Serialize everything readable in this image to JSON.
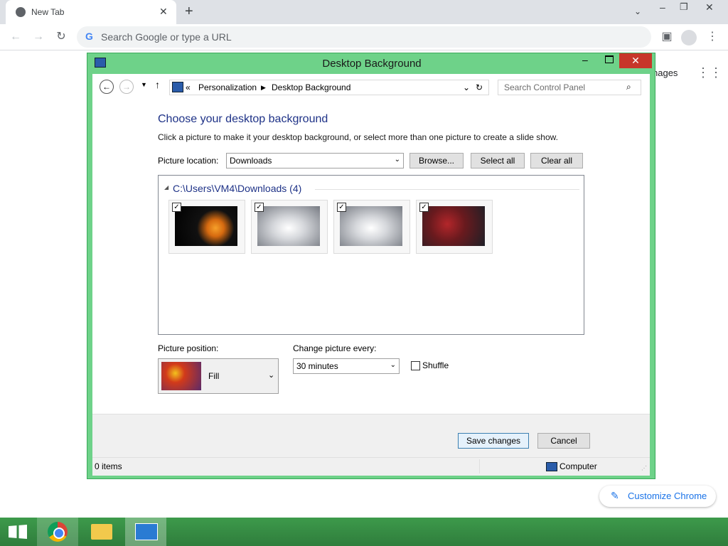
{
  "browser": {
    "tab_title": "New Tab",
    "omnibox_placeholder": "Search Google or type a URL",
    "partial_images_link": "nages",
    "customize_label": "Customize Chrome"
  },
  "window": {
    "title": "Desktop Background",
    "breadcrumb": [
      "Personalization",
      "Desktop Background"
    ],
    "breadcrumb_prefix": "«",
    "search_placeholder": "Search Control Panel",
    "heading": "Choose your desktop background",
    "subtext": "Click a picture to make it your desktop background, or select more than one picture to create a slide show.",
    "picture_location_label": "Picture location:",
    "picture_location_value": "Downloads",
    "browse_label": "Browse...",
    "select_all_label": "Select all",
    "clear_all_label": "Clear all",
    "group_label": "C:\\Users\\VM4\\Downloads (4)",
    "thumbnails": [
      {
        "name": "windows-logo-wallpaper",
        "checked": true
      },
      {
        "name": "gray-gradient-wallpaper-1",
        "checked": true
      },
      {
        "name": "gray-gradient-wallpaper-2",
        "checked": true
      },
      {
        "name": "red-soldiers-wallpaper",
        "checked": true
      }
    ],
    "picture_position_label": "Picture position:",
    "picture_position_value": "Fill",
    "change_every_label": "Change picture every:",
    "change_every_value": "30 minutes",
    "shuffle_label": "Shuffle",
    "save_label": "Save changes",
    "cancel_label": "Cancel",
    "status_items": "0 items",
    "status_computer": "Computer"
  },
  "colors": {
    "window_frame": "#6ed289",
    "close_button": "#c7362a",
    "heading": "#1e3287",
    "taskbar": "#2f7d3c"
  }
}
